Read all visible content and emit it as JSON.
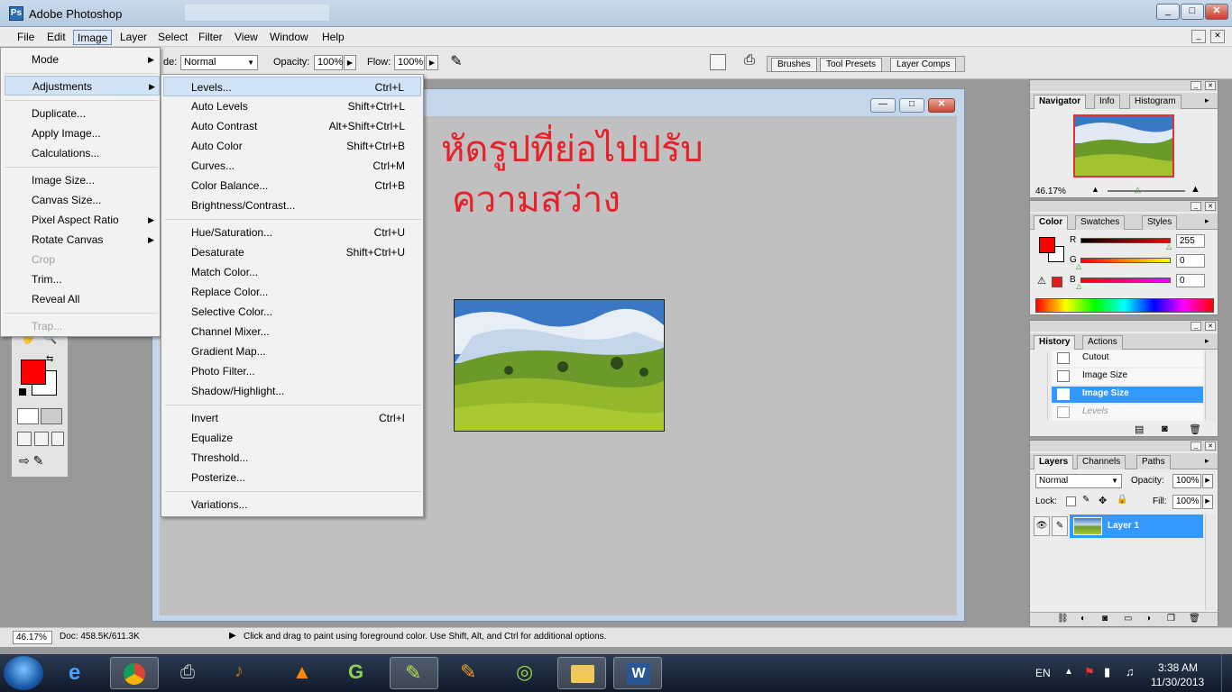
{
  "window": {
    "title": "Adobe Photoshop"
  },
  "menubar": [
    "File",
    "Edit",
    "Image",
    "Layer",
    "Select",
    "Filter",
    "View",
    "Window",
    "Help"
  ],
  "options": {
    "mode_prefix": "de:",
    "mode_value": "Normal",
    "opacity_label": "Opacity:",
    "opacity_value": "100%",
    "flow_label": "Flow:",
    "flow_value": "100%",
    "panel_tabs": [
      "Brushes",
      "Tool Presets",
      "Layer Comps"
    ]
  },
  "image_menu": {
    "items": [
      {
        "label": "Mode",
        "submenu": true
      },
      {
        "label": "Adjustments",
        "submenu": true,
        "highlighted": true
      },
      {
        "label": "Duplicate..."
      },
      {
        "label": "Apply Image..."
      },
      {
        "label": "Calculations..."
      },
      {
        "label": "Image Size..."
      },
      {
        "label": "Canvas Size..."
      },
      {
        "label": "Pixel Aspect Ratio",
        "submenu": true
      },
      {
        "label": "Rotate Canvas",
        "submenu": true
      },
      {
        "label": "Crop",
        "disabled": true
      },
      {
        "label": "Trim..."
      },
      {
        "label": "Reveal All"
      },
      {
        "label": "Trap...",
        "disabled": true
      }
    ]
  },
  "adjustments_menu": {
    "items": [
      {
        "label": "Levels...",
        "shortcut": "Ctrl+L",
        "highlighted": true
      },
      {
        "label": "Auto Levels",
        "shortcut": "Shift+Ctrl+L"
      },
      {
        "label": "Auto Contrast",
        "shortcut": "Alt+Shift+Ctrl+L"
      },
      {
        "label": "Auto Color",
        "shortcut": "Shift+Ctrl+B"
      },
      {
        "label": "Curves...",
        "shortcut": "Ctrl+M"
      },
      {
        "label": "Color Balance...",
        "shortcut": "Ctrl+B"
      },
      {
        "label": "Brightness/Contrast...",
        "shortcut": ""
      },
      {
        "label": "Hue/Saturation...",
        "shortcut": "Ctrl+U"
      },
      {
        "label": "Desaturate",
        "shortcut": "Shift+Ctrl+U"
      },
      {
        "label": "Match Color...",
        "shortcut": ""
      },
      {
        "label": "Replace Color...",
        "shortcut": ""
      },
      {
        "label": "Selective Color...",
        "shortcut": ""
      },
      {
        "label": "Channel Mixer...",
        "shortcut": ""
      },
      {
        "label": "Gradient Map...",
        "shortcut": ""
      },
      {
        "label": "Photo Filter...",
        "shortcut": ""
      },
      {
        "label": "Shadow/Highlight...",
        "shortcut": ""
      },
      {
        "label": "Invert",
        "shortcut": "Ctrl+I"
      },
      {
        "label": "Equalize",
        "shortcut": ""
      },
      {
        "label": "Threshold...",
        "shortcut": ""
      },
      {
        "label": "Posterize...",
        "shortcut": ""
      },
      {
        "label": "Variations...",
        "shortcut": ""
      }
    ]
  },
  "annotation": {
    "line1": "หัดรูปที่ย่อไปปรับ",
    "line2": "ความสว่าง"
  },
  "navigator": {
    "tabs": [
      "Navigator",
      "Info",
      "Histogram"
    ],
    "zoom": "46.17%"
  },
  "color_panel": {
    "tabs": [
      "Color",
      "Swatches",
      "Styles"
    ],
    "r_label": "R",
    "g_label": "G",
    "b_label": "B",
    "r": "255",
    "g": "0",
    "b": "0",
    "fg_color": "#ff0000"
  },
  "history": {
    "tabs": [
      "History",
      "Actions"
    ],
    "items": [
      {
        "label": "Cutout"
      },
      {
        "label": "Image Size"
      },
      {
        "label": "Image Size",
        "selected": true
      },
      {
        "label": "Levels",
        "dimmed": true
      }
    ]
  },
  "layers": {
    "tabs": [
      "Layers",
      "Channels",
      "Paths"
    ],
    "blend": "Normal",
    "opacity_label": "Opacity:",
    "opacity": "100%",
    "lock_label": "Lock:",
    "fill_label": "Fill:",
    "fill": "100%",
    "layer_name": "Layer 1"
  },
  "status": {
    "zoom": "46.17%",
    "doc": "Doc: 458.5K/611.3K",
    "hint": "Click and drag to paint using foreground color.  Use Shift, Alt, and Ctrl for additional options."
  },
  "taskbar": {
    "lang": "EN",
    "time": "3:38 AM",
    "date": "11/30/2013"
  },
  "colors": {
    "accent_select": "#3399ff",
    "menu_highlight": "#d3e3f6",
    "annotation": "#e8202a"
  }
}
